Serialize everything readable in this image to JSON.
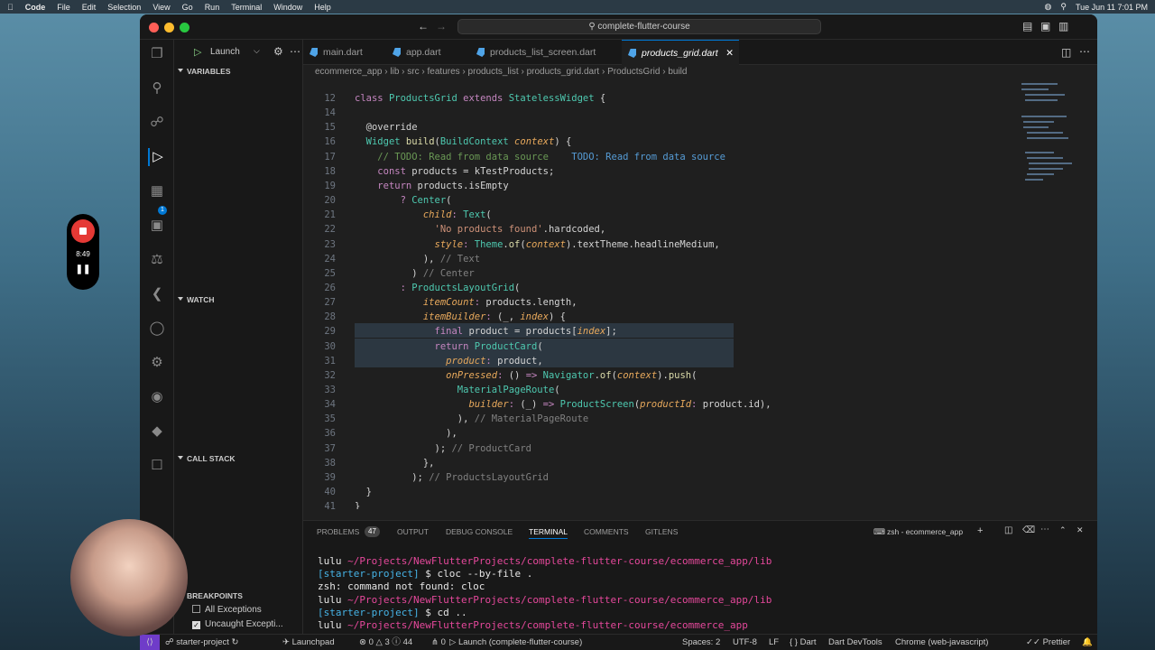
{
  "menubar": {
    "app": "Code",
    "items": [
      "File",
      "Edit",
      "Selection",
      "View",
      "Go",
      "Run",
      "Terminal",
      "Window",
      "Help"
    ],
    "clock": "Tue Jun 11  7:01 PM"
  },
  "titlebar": {
    "search": "complete-flutter-course"
  },
  "debug": {
    "config": "Launch"
  },
  "sidebar": {
    "variables": "VARIABLES",
    "watch": "WATCH",
    "callstack": "CALL STACK",
    "breakpoints": "BREAKPOINTS",
    "bp1": "All Exceptions",
    "bp2": "Uncaught Excepti..."
  },
  "recorder": {
    "time": "8:49"
  },
  "tabs": [
    "main.dart",
    "app.dart",
    "products_list_screen.dart",
    "products_grid.dart"
  ],
  "breadcrumb": [
    "ecommerce_app",
    "lib",
    "src",
    "features",
    "products_list",
    "products_grid.dart",
    "ProductsGrid",
    "build"
  ],
  "code": [
    {
      "n": "12",
      "html": "<span class='kw'>class</span> <span class='ty'>ProductsGrid</span> <span class='kw'>extends</span> <span class='ty'>StatelessWidget</span> {"
    },
    {
      "n": "14",
      "html": ""
    },
    {
      "n": "15",
      "html": "  <span class='ann'>@override</span>"
    },
    {
      "n": "16",
      "html": "  <span class='ty'>Widget</span> <span class='fn'>build</span>(<span class='ty'>BuildContext</span> <span class='pm'>context</span>) {"
    },
    {
      "n": "17",
      "html": "    <span class='cm'>// TODO: Read from data source</span>    <span class='todo'>TODO: Read from data source</span>"
    },
    {
      "n": "18",
      "html": "    <span class='kw'>const</span> products = kTestProducts;"
    },
    {
      "n": "19",
      "html": "    <span class='kw'>return</span> products.isEmpty"
    },
    {
      "n": "20",
      "html": "        <span class='kw'>?</span> <span class='ty'>Center</span>("
    },
    {
      "n": "21",
      "html": "            <span class='pm'>child</span><span class='kw'>:</span> <span class='ty'>Text</span>("
    },
    {
      "n": "22",
      "html": "              <span class='str'>'No products found'</span>.hardcoded,"
    },
    {
      "n": "23",
      "html": "              <span class='pm'>style</span><span class='kw'>:</span> <span class='ty'>Theme</span>.<span class='fn'>of</span>(<span class='pm'>context</span>).textTheme.headlineMedium,"
    },
    {
      "n": "24",
      "html": "            ), <span class='gray'>// Text</span>"
    },
    {
      "n": "25",
      "html": "          ) <span class='gray'>// Center</span>"
    },
    {
      "n": "26",
      "html": "        <span class='kw'>:</span> <span class='ty'>ProductsLayoutGrid</span>("
    },
    {
      "n": "27",
      "html": "            <span class='pm'>itemCount</span><span class='kw'>:</span> products.length,"
    },
    {
      "n": "28",
      "html": "            <span class='pm'>itemBuilder</span><span class='kw'>:</span> (_, <span class='pm'>index</span>) {"
    },
    {
      "n": "29",
      "html": "              <span class='kw'>final</span> product = products[<span class='pm'>index</span>];"
    },
    {
      "n": "30",
      "html": "              <span class='kw'>return</span> <span class='ty'>ProductCard</span>("
    },
    {
      "n": "31",
      "html": "                <span class='pm'>product</span><span class='kw'>:</span> product,"
    },
    {
      "n": "32",
      "html": "                <span class='pm'>onPressed</span><span class='kw'>:</span> () <span class='kw'>=></span> <span class='ty'>Navigator</span>.<span class='fn'>of</span>(<span class='pm'>context</span>).<span class='fn'>push</span>("
    },
    {
      "n": "33",
      "html": "                  <span class='ty'>MaterialPageRoute</span>("
    },
    {
      "n": "34",
      "html": "                    <span class='pm'>builder</span><span class='kw'>:</span> (_) <span class='kw'>=></span> <span class='ty'>ProductScreen</span>(<span class='pm'>productId</span><span class='kw'>:</span> product.id),"
    },
    {
      "n": "35",
      "html": "                  ), <span class='gray'>// MaterialPageRoute</span>"
    },
    {
      "n": "36",
      "html": "                ),"
    },
    {
      "n": "37",
      "html": "              ); <span class='gray'>// ProductCard</span>"
    },
    {
      "n": "38",
      "html": "            },"
    },
    {
      "n": "39",
      "html": "          ); <span class='gray'>// ProductsLayoutGrid</span>"
    },
    {
      "n": "40",
      "html": "  }"
    },
    {
      "n": "41",
      "html": "}"
    }
  ],
  "panel": {
    "tabs": [
      "PROBLEMS",
      "OUTPUT",
      "DEBUG CONSOLE",
      "TERMINAL",
      "COMMENTS",
      "GITLENS"
    ],
    "problems_count": "47",
    "shell": "zsh - ecommerce_app"
  },
  "terminal": [
    {
      "kind": "path",
      "user": "lulu",
      "path": "~/Projects/NewFlutterProjects/complete-flutter-course/ecommerce_app/lib"
    },
    {
      "kind": "cmd",
      "branch": "[starter-project]",
      "cmd": "$ cloc --by-file ."
    },
    {
      "kind": "out",
      "text": "zsh: command not found: cloc"
    },
    {
      "kind": "path",
      "user": "lulu",
      "path": "~/Projects/NewFlutterProjects/complete-flutter-course/ecommerce_app/lib"
    },
    {
      "kind": "cmd",
      "branch": "[starter-project]",
      "cmd": "$ cd .."
    },
    {
      "kind": "path",
      "user": "lulu",
      "path": "~/Projects/NewFlutterProjects/complete-flutter-course/ecommerce_app"
    },
    {
      "kind": "cmd",
      "branch": "[starter-project]",
      "cmd": "$ "
    }
  ],
  "status": {
    "branch": "starter-project",
    "launchpad": "Launchpad",
    "errors": "0",
    "warnings": "3",
    "info": "44",
    "ports": "0",
    "launch": "Launch (complete-flutter-course)",
    "spaces": "Spaces: 2",
    "enc": "UTF-8",
    "eol": "LF",
    "lang": "Dart",
    "devtools": "Dart DevTools",
    "device": "Chrome (web-javascript)",
    "prettier": "Prettier"
  }
}
